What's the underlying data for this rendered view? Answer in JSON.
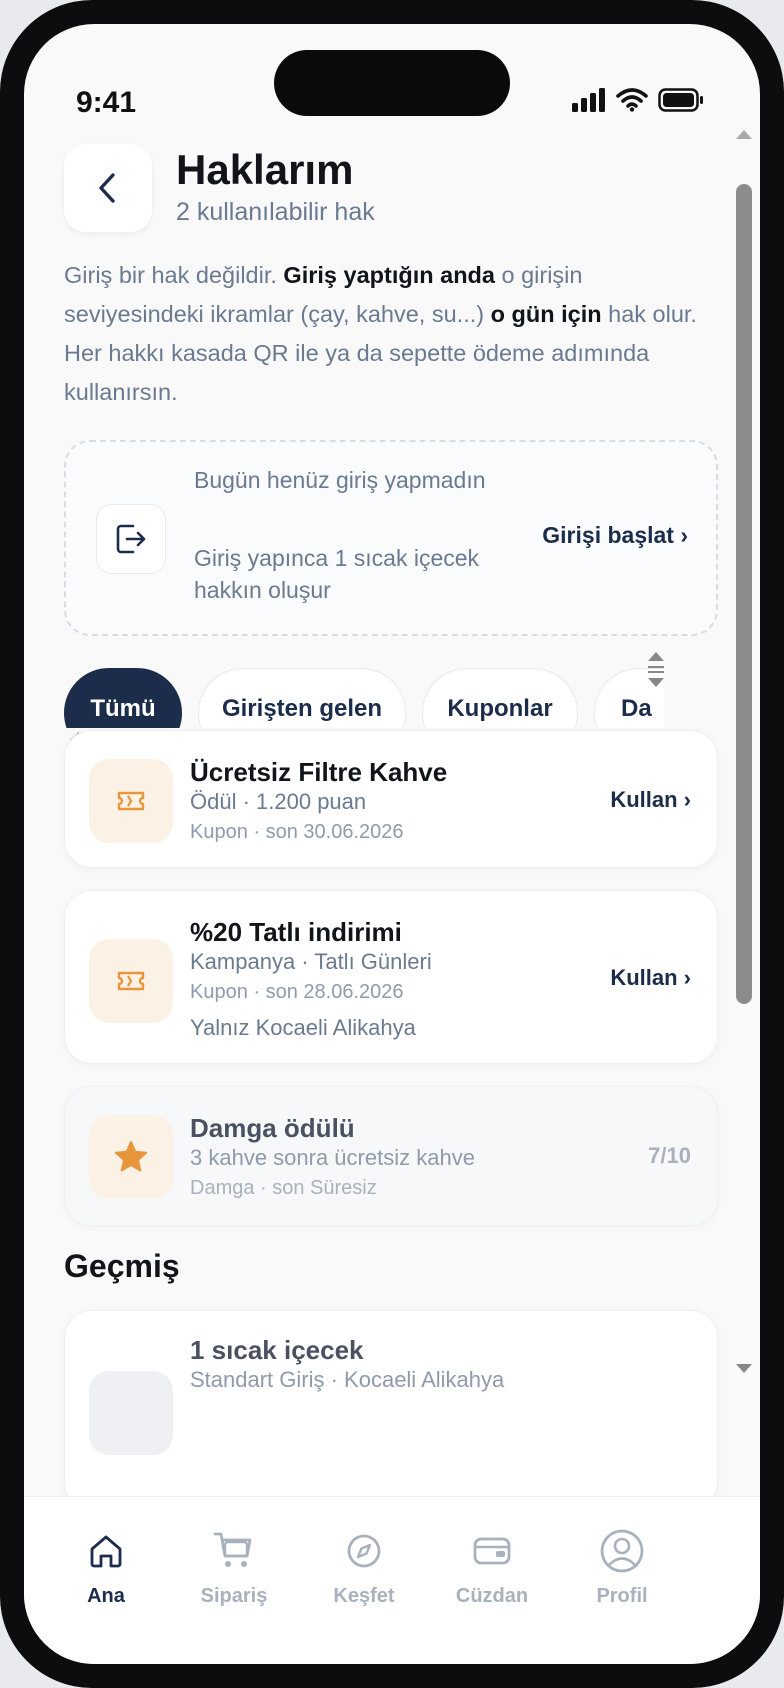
{
  "status_bar": {
    "time": "9:41"
  },
  "header": {
    "title": "Haklarım",
    "subtitle": "2 kullanılabilir hak"
  },
  "intro": {
    "part1": "Giriş bir hak değildir. ",
    "bold1": "Giriş yaptığın anda",
    "part2": " o girişin seviyesindeki ikramlar (çay, kahve, su...) ",
    "bold2": "o gün için",
    "part3": " hak olur. Her hakkı kasada QR ile ya da sepette ödeme adımında kullanırsın."
  },
  "checkin": {
    "title": "Bugün henüz giriş yapmadın",
    "description": "Giriş yapınca 1 sıcak içecek hakkın oluşur",
    "cta": "Girişi başlat ›"
  },
  "filters": [
    {
      "label": "Tümü",
      "active": true
    },
    {
      "label": "Girişten gelen",
      "active": false
    },
    {
      "label": "Kuponlar",
      "active": false
    },
    {
      "label": "Da",
      "active": false
    }
  ],
  "rights": [
    {
      "icon": "ticket-icon",
      "title": "Ücretsiz Filtre Kahve",
      "subtitle": "Ödül · 1.200 puan",
      "meta": "Kupon · son 30.06.2026",
      "cta": "Kullan ›"
    },
    {
      "icon": "ticket-icon",
      "title": "%20 Tatlı indirimi",
      "subtitle": "Kampanya · Tatlı Günleri",
      "meta": "Kupon · son 28.06.2026",
      "note": "Yalnız Kocaeli Alikahya",
      "cta": "Kullan ›"
    },
    {
      "icon": "star-icon",
      "title": "Damga ödülü",
      "subtitle": "3 kahve sonra ücretsiz kahve",
      "meta": "Damga · son Süresiz",
      "progress": "7/10"
    }
  ],
  "history": {
    "title": "Geçmiş",
    "items": [
      {
        "title": "1 sıcak içecek",
        "subtitle": "Standart Giriş · Kocaeli Alikahya"
      }
    ]
  },
  "tabbar": [
    {
      "label": "Ana",
      "icon": "home-icon",
      "active": true
    },
    {
      "label": "Sipariş",
      "icon": "cart-icon",
      "active": false
    },
    {
      "label": "Keşfet",
      "icon": "compass-icon",
      "active": false
    },
    {
      "label": "Cüzdan",
      "icon": "wallet-icon",
      "active": false
    },
    {
      "label": "Profil",
      "icon": "profile-icon",
      "active": false
    }
  ],
  "colors": {
    "primary": "#1c2c4b",
    "muted_text": "#6b7a90",
    "accent_orange": "#e8963c",
    "thumb_bg": "#fbf1e4"
  }
}
